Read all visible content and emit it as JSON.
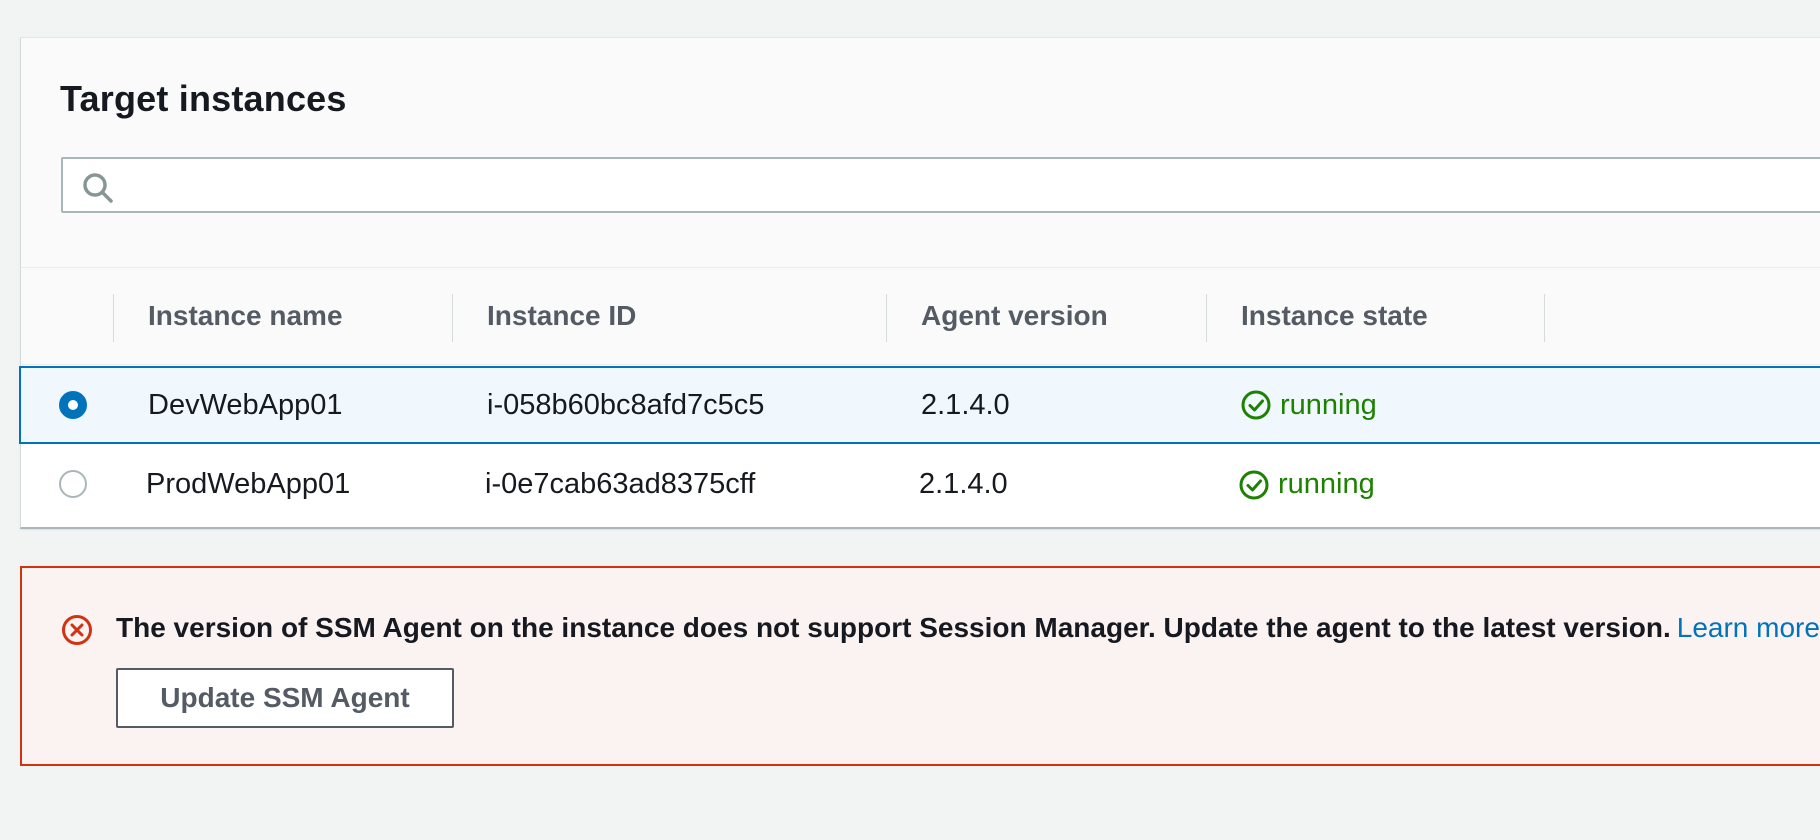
{
  "panel": {
    "title": "Target instances",
    "search": {
      "value": "",
      "placeholder": "",
      "icon": "search-icon"
    }
  },
  "table": {
    "columns": [
      "Instance name",
      "Instance ID",
      "Agent version",
      "Instance state"
    ],
    "rows": [
      {
        "selected": true,
        "name": "DevWebApp01",
        "id": "i-058b60bc8afd7c5c5",
        "agent_version": "2.1.4.0",
        "state": "running",
        "state_icon": "check-circle-icon"
      },
      {
        "selected": false,
        "name": "ProdWebApp01",
        "id": "i-0e7cab63ad8375cff",
        "agent_version": "2.1.4.0",
        "state": "running",
        "state_icon": "check-circle-icon"
      }
    ]
  },
  "alert": {
    "type": "error",
    "icon": "error-circle-icon",
    "message": "The version of SSM Agent on the instance does not support Session Manager. Update the agent to the latest version.",
    "link_text": "Learn more",
    "button_label": "Update SSM Agent"
  },
  "colors": {
    "accent": "#0073bb",
    "success": "#1d8102",
    "error": "#d13212",
    "error_background": "#fbf2f2"
  }
}
